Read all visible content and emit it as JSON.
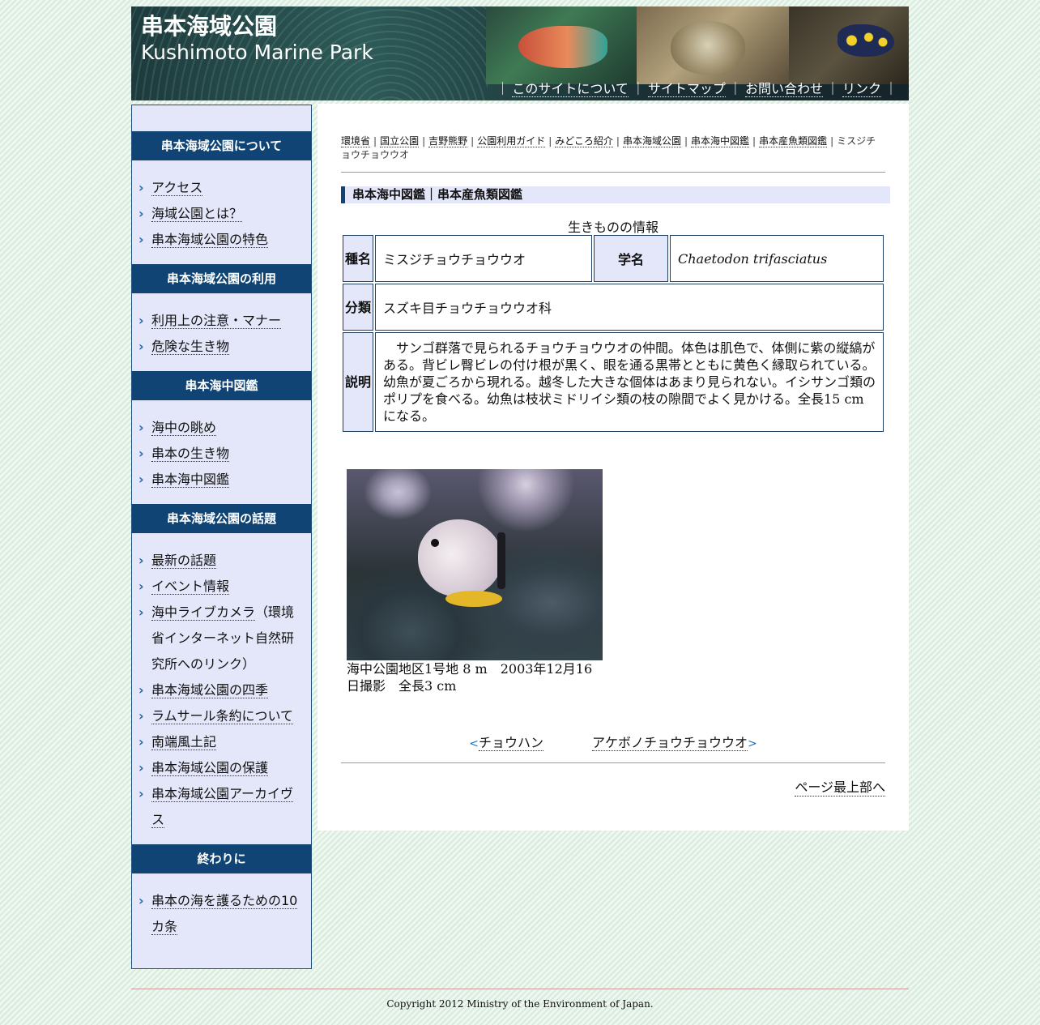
{
  "header": {
    "title_jp": "串本海域公園",
    "title_en": "Kushimoto Marine Park",
    "nav": [
      "このサイトについて",
      "サイトマップ",
      "お問い合わせ",
      "リンク"
    ],
    "sep": "｜"
  },
  "sidebar": {
    "sections": [
      {
        "heading": "串本海域公園について",
        "items": [
          "アクセス",
          "海域公園とは？",
          "串本海域公園の特色"
        ]
      },
      {
        "heading": "串本海域公園の利用",
        "items": [
          "利用上の注意・マナー",
          "危険な生き物"
        ]
      },
      {
        "heading": "串本海中図鑑",
        "items": [
          "海中の眺め",
          "串本の生き物",
          "串本海中図鑑"
        ]
      },
      {
        "heading": "串本海域公園の話題",
        "items": [
          "最新の話題",
          "イベント情報",
          "海中ライブカメラ",
          "串本海域公園の四季",
          "ラムサール条約について",
          "南端風土記",
          "串本海域公園の保護",
          "串本海域公園アーカイヴス"
        ],
        "note": "（環境省インターネット自然研究所へのリンク）"
      },
      {
        "heading": "終わりに",
        "items": [
          "串本の海を護るための10カ条"
        ]
      }
    ]
  },
  "breadcrumb": {
    "items": [
      "環境省",
      "国立公園",
      "吉野熊野",
      "公園利用ガイド",
      "みどころ紹介",
      "串本海域公園",
      "串本海中図鑑",
      "串本産魚類図鑑"
    ],
    "current": "ミスジチョウチョウウオ",
    "sep": "|"
  },
  "section_title": "串本海中図鑑｜串本産魚類図鑑",
  "info": {
    "caption": "生きものの情報",
    "species_label": "種名",
    "species": "ミスジチョウチョウウオ",
    "sci_label": "学名",
    "scientific": "Chaetodon trifasciatus",
    "class_label": "分類",
    "classification": "スズキ目チョウチョウウオ科",
    "desc_label": "説明",
    "description": "サンゴ群落で見られるチョウチョウウオの仲間。体色は肌色で、体側に紫の縦縞がある。背ビレ臀ビレの付け根が黒く、眼を通る黒帯とともに黄色く縁取られている。幼魚が夏ごろから現れる。越冬した大きな個体はあまり見られない。イシサンゴ類のポリプを食べる。幼魚は枝状ミドリイシ類の枝の隙間でよく見かける。全長15 cmになる。"
  },
  "photo_caption": "海中公園地区1号地 8 m　2003年12月16日撮影　全長3 cm",
  "prevnext": {
    "prev": "チョウハン",
    "next": "アケボノチョウチョウウオ",
    "prev_arrow": "<",
    "next_arrow": ">"
  },
  "pagetop": "ページ最上部へ",
  "copyright": "Copyright 2012 Ministry of the Environment of Japan.",
  "colors": {
    "sidebar_head": "#0f4475",
    "sidebar_bg": "#e4e7fa",
    "link_arrow": "#1b6cb0"
  }
}
